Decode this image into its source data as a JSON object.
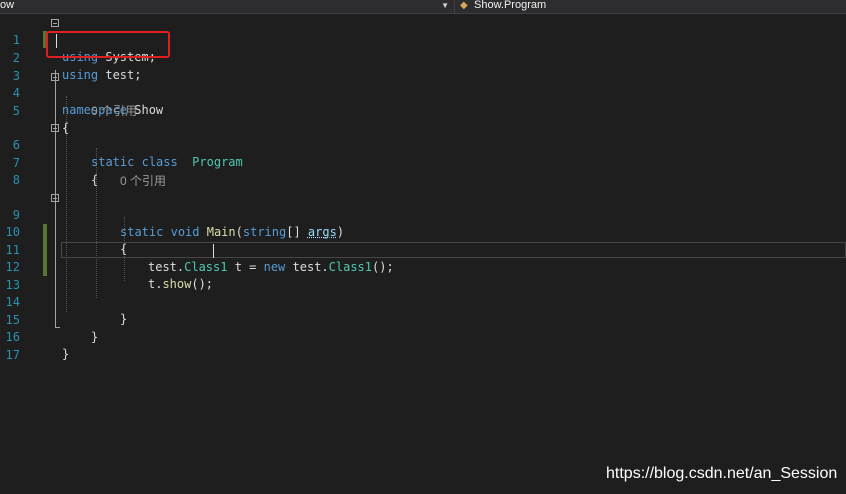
{
  "navbar": {
    "left_project": "ow",
    "right_member": "Show.Program"
  },
  "editor": {
    "line_numbers": [
      "1",
      "2",
      "3",
      "4",
      "5",
      "6",
      "7",
      "8",
      "9",
      "10",
      "11",
      "12",
      "13",
      "14",
      "15",
      "16",
      "17"
    ],
    "codelens": {
      "class_refs": "0 个引用",
      "method_refs": "0 个引用"
    },
    "code": {
      "l1_kw": "using",
      "l1_rest": " System;",
      "l2_kw": "using",
      "l2_rest": " test;",
      "l4_kw": "namespace",
      "l4_rest": " Show",
      "l5": "{",
      "l6_kw1": "static",
      "l6_kw2": "class",
      "l6_type": "Program",
      "l7": "{",
      "l9_kw1": "static",
      "l9_kw2": "void",
      "l9_method": "Main",
      "l9_p1": "(",
      "l9_kw3": "string",
      "l9_p2": "[] ",
      "l9_param": "args",
      "l9_p3": ")",
      "l10": "{",
      "l11_a": "test.",
      "l11_type": "Class1",
      "l11_b": " t = ",
      "l11_kw": "new",
      "l11_c": " test.",
      "l11_type2": "Class1",
      "l11_d": "();",
      "l12_a": "t.",
      "l12_method": "show",
      "l12_b": "();",
      "l14": "}",
      "l15": "}",
      "l16": "}"
    }
  },
  "watermark": "https://blog.csdn.net/an_Session",
  "colors": {
    "background": "#1e1e1e",
    "keyword": "#569cd6",
    "type": "#4ec9b0",
    "method": "#dcdcaa",
    "line_number": "#2b91af",
    "highlight_box": "#e02020"
  }
}
